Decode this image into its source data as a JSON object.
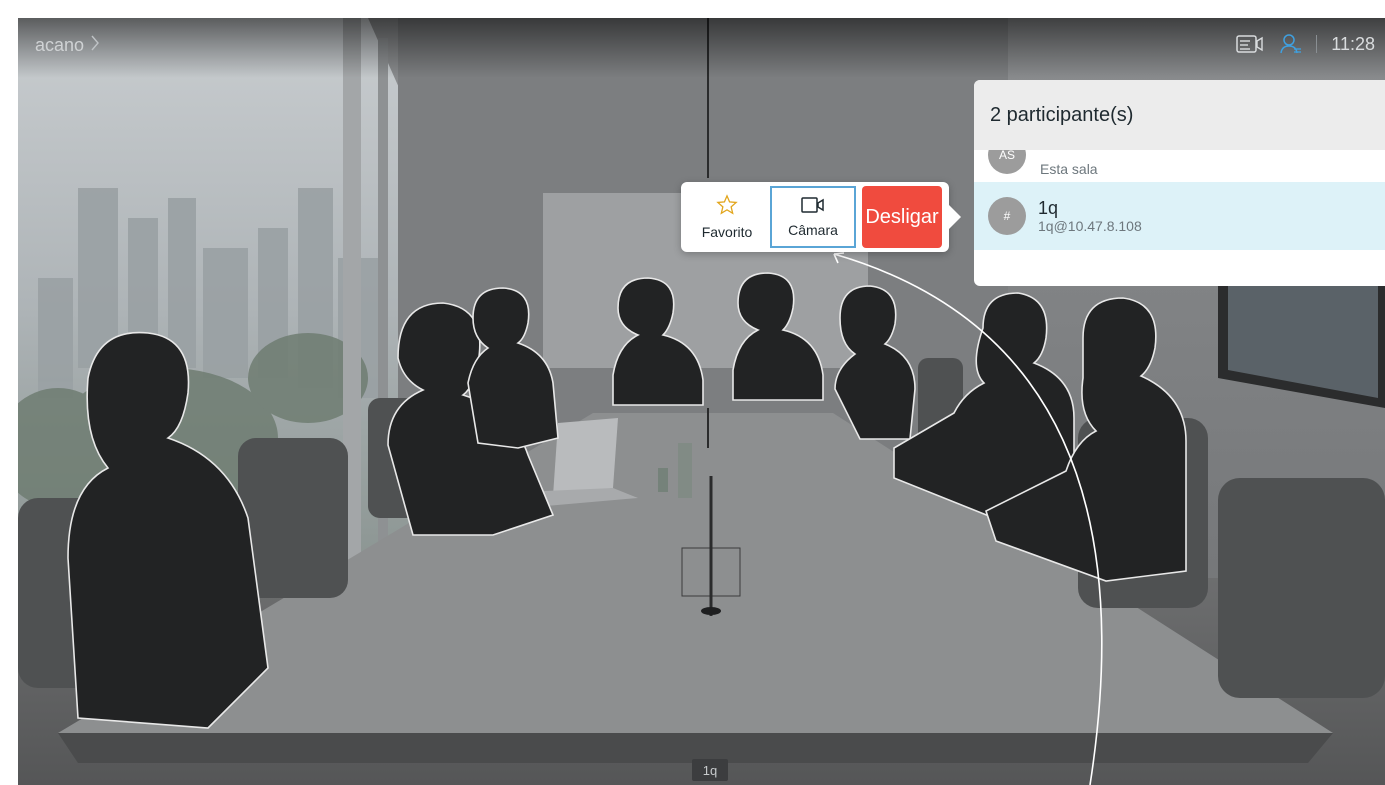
{
  "breadcrumb": {
    "label": "acano"
  },
  "status": {
    "time": "11:28"
  },
  "icons": {
    "breadcrumb_chevron": "chevron-right-icon",
    "layout": "layout-switch-icon",
    "participants": "participants-icon",
    "favorite": "star-icon",
    "camera": "camera-icon"
  },
  "popover": {
    "favorite_label": "Favorito",
    "camera_label": "Câmara",
    "hangup_label": "Desligar"
  },
  "participants": {
    "header": "2 participante(s)",
    "items": [
      {
        "initials": "AS",
        "name": "",
        "subtitle": "Esta sala"
      },
      {
        "initials": "#",
        "name": "1q",
        "subtitle": "1q@10.47.8.108"
      }
    ]
  },
  "video": {
    "name_tag": "1q"
  },
  "colors": {
    "accent": "#5aa5d6",
    "hangup": "#f04b3e",
    "selected_row": "#ddf2f8",
    "panel_header": "#ececec"
  }
}
